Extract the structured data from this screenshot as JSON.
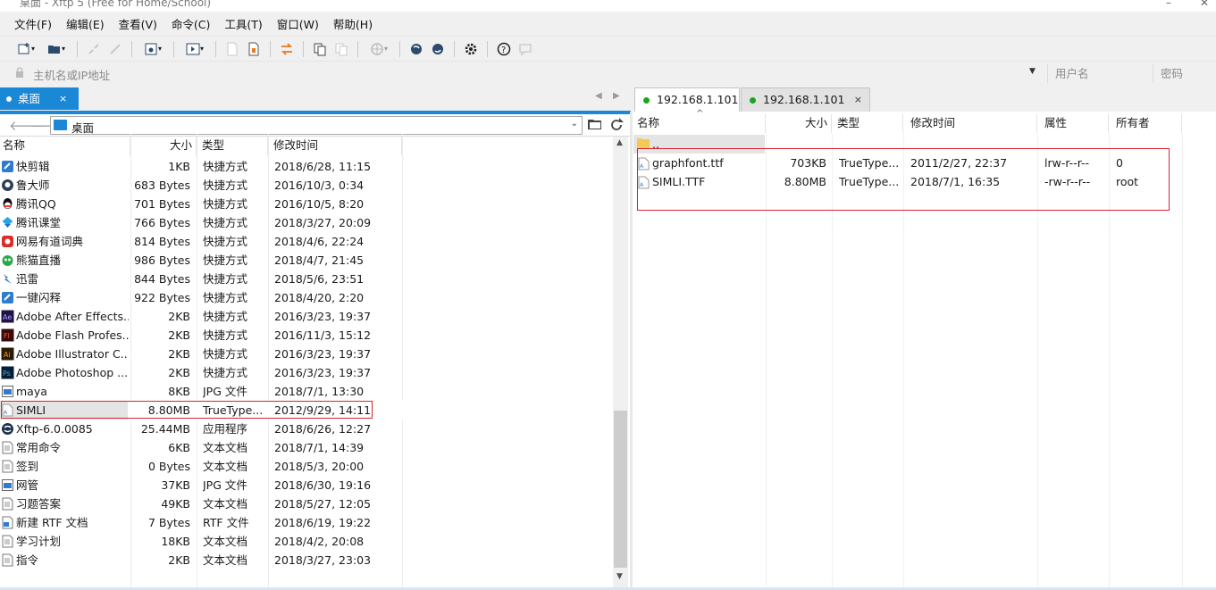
{
  "window": {
    "title": "桌面 - Xftp 5 (Free for Home/School)"
  },
  "menu": [
    "文件(F)",
    "编辑(E)",
    "查看(V)",
    "命令(C)",
    "工具(T)",
    "窗口(W)",
    "帮助(H)"
  ],
  "address": {
    "host_placeholder": "主机名或IP地址",
    "user_placeholder": "用户名",
    "password_placeholder": "密码"
  },
  "local": {
    "tab_label": "桌面",
    "path": "桌面",
    "columns": {
      "name": "名称",
      "size": "大小",
      "type": "类型",
      "modified": "修改时间"
    },
    "files": [
      {
        "name": "快剪辑",
        "size": "1KB",
        "type": "快捷方式",
        "modified": "2018/6/28, 11:15",
        "icon": "shortcut-blue-icon"
      },
      {
        "name": "鲁大师",
        "size": "683 Bytes",
        "type": "快捷方式",
        "modified": "2016/10/3, 0:34",
        "icon": "ludashi-icon"
      },
      {
        "name": "腾讯QQ",
        "size": "701 Bytes",
        "type": "快捷方式",
        "modified": "2016/10/5, 8:20",
        "icon": "qq-icon"
      },
      {
        "name": "腾讯课堂",
        "size": "766 Bytes",
        "type": "快捷方式",
        "modified": "2018/3/27, 20:09",
        "icon": "tencent-class-icon"
      },
      {
        "name": "网易有道词典",
        "size": "814 Bytes",
        "type": "快捷方式",
        "modified": "2018/4/6, 22:24",
        "icon": "youdao-icon"
      },
      {
        "name": "熊猫直播",
        "size": "986 Bytes",
        "type": "快捷方式",
        "modified": "2018/4/7, 21:45",
        "icon": "panda-icon"
      },
      {
        "name": "迅雷",
        "size": "844 Bytes",
        "type": "快捷方式",
        "modified": "2018/5/6, 23:51",
        "icon": "thunder-icon"
      },
      {
        "name": "一键闪释",
        "size": "922 Bytes",
        "type": "快捷方式",
        "modified": "2018/4/20, 2:20",
        "icon": "shortcut-blue-icon"
      },
      {
        "name": "Adobe After Effects...",
        "size": "2KB",
        "type": "快捷方式",
        "modified": "2016/3/23, 19:37",
        "icon": "after-effects-icon"
      },
      {
        "name": "Adobe Flash Profes...",
        "size": "2KB",
        "type": "快捷方式",
        "modified": "2016/11/3, 15:12",
        "icon": "flash-icon"
      },
      {
        "name": "Adobe Illustrator C...",
        "size": "2KB",
        "type": "快捷方式",
        "modified": "2016/3/23, 19:37",
        "icon": "illustrator-icon"
      },
      {
        "name": "Adobe Photoshop ...",
        "size": "2KB",
        "type": "快捷方式",
        "modified": "2016/3/23, 19:37",
        "icon": "photoshop-icon"
      },
      {
        "name": "maya",
        "size": "8KB",
        "type": "JPG 文件",
        "modified": "2018/7/1, 13:30",
        "icon": "image-file-icon"
      },
      {
        "name": "SIMLI",
        "size": "8.80MB",
        "type": "TrueType...",
        "modified": "2012/9/29, 14:11",
        "icon": "font-file-icon"
      },
      {
        "name": "Xftp-6.0.0085",
        "size": "25.44MB",
        "type": "应用程序",
        "modified": "2018/6/26, 12:27",
        "icon": "xftp-installer-icon"
      },
      {
        "name": "常用命令",
        "size": "6KB",
        "type": "文本文档",
        "modified": "2018/7/1, 14:39",
        "icon": "text-file-icon"
      },
      {
        "name": "签到",
        "size": "0 Bytes",
        "type": "文本文档",
        "modified": "2018/5/3, 20:00",
        "icon": "text-file-icon"
      },
      {
        "name": "网管",
        "size": "37KB",
        "type": "JPG 文件",
        "modified": "2018/6/30, 19:16",
        "icon": "image-file-icon"
      },
      {
        "name": "习题答案",
        "size": "49KB",
        "type": "文本文档",
        "modified": "2018/5/27, 12:05",
        "icon": "text-file-icon"
      },
      {
        "name": "新建 RTF 文档",
        "size": "7 Bytes",
        "type": "RTF 文件",
        "modified": "2018/6/19, 19:22",
        "icon": "rtf-file-icon"
      },
      {
        "name": "学习计划",
        "size": "18KB",
        "type": "文本文档",
        "modified": "2018/4/2, 20:08",
        "icon": "text-file-icon"
      },
      {
        "name": "指令",
        "size": "2KB",
        "type": "文本文档",
        "modified": "2018/3/27, 23:03",
        "icon": "text-file-icon"
      }
    ]
  },
  "remote": {
    "tabs": [
      {
        "label": "192.168.1.101"
      },
      {
        "label": "192.168.1.101"
      }
    ],
    "columns": {
      "name": "名称",
      "size": "大小",
      "type": "类型",
      "modified": "修改时间",
      "attr": "属性",
      "owner": "所有者"
    },
    "updir": "..",
    "files": [
      {
        "name": "graphfont.ttf",
        "size": "703KB",
        "type": "TrueType...",
        "modified": "2011/2/27, 22:37",
        "attr": "lrw-r--r--",
        "owner": "0",
        "icon": "font-file-icon"
      },
      {
        "name": "SIMLI.TTF",
        "size": "8.80MB",
        "type": "TrueType...",
        "modified": "2018/7/1, 16:35",
        "attr": "-rw-r--r--",
        "owner": "root",
        "icon": "font-file-icon"
      }
    ]
  },
  "colors": {
    "accent": "#1a88d4",
    "highlight_box": "#d8242f",
    "connected": "#19a51f"
  }
}
